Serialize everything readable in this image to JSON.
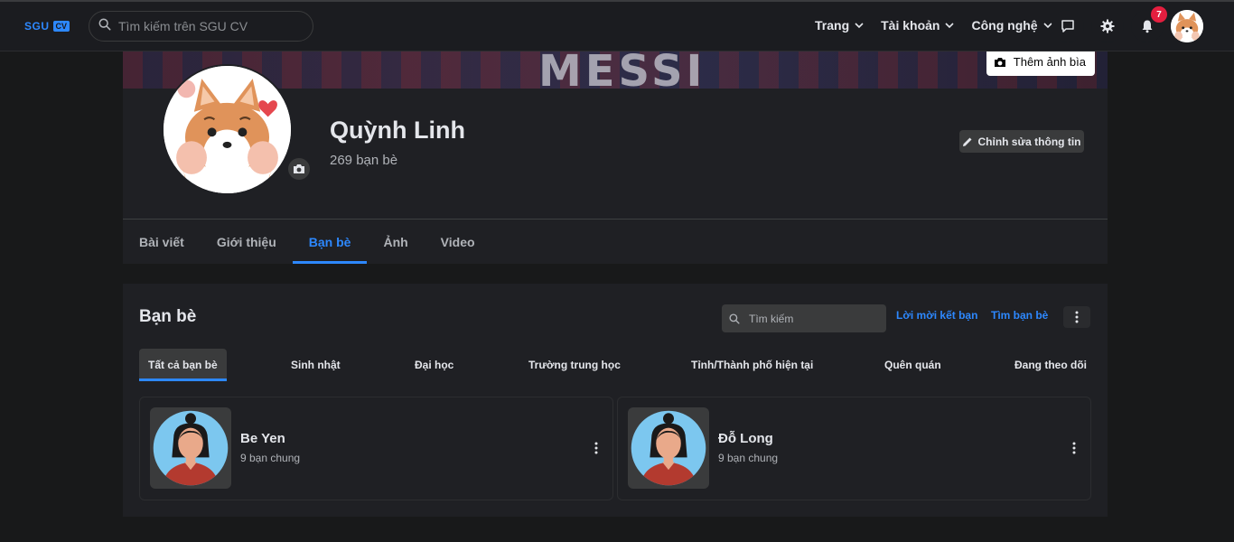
{
  "nav": {
    "logo_text": "SGU",
    "logo_badge": "CV",
    "search_placeholder": "Tìm kiếm trên SGU CV",
    "menus": [
      "Trang",
      "Tài khoản",
      "Công nghệ"
    ],
    "notification_count": "7"
  },
  "profile": {
    "cover_text": "MESSI",
    "add_cover_label": "Thêm ảnh bìa",
    "name": "Quỳnh Linh",
    "friend_count": "269 bạn bè",
    "edit_label": "Chỉnh sửa thông tin",
    "tabs": [
      {
        "label": "Bài viết",
        "active": false
      },
      {
        "label": "Giới thiệu",
        "active": false
      },
      {
        "label": "Bạn bè",
        "active": true
      },
      {
        "label": "Ảnh",
        "active": false
      },
      {
        "label": "Video",
        "active": false
      }
    ]
  },
  "friends": {
    "title": "Bạn bè",
    "search_placeholder": "Tìm kiếm",
    "requests_link": "Lời mời kết bạn",
    "find_link": "Tìm bạn bè",
    "tabs": [
      "Tất cả bạn bè",
      "Sinh nhật",
      "Đại học",
      "Trường trung học",
      "Tỉnh/Thành phố hiện tại",
      "Quên quán",
      "Đang theo dõi"
    ],
    "list": [
      {
        "name": "Be Yen",
        "mutual": "9 bạn chung"
      },
      {
        "name": "Đỗ Long",
        "mutual": "9 bạn chung"
      }
    ]
  },
  "colors": {
    "accent": "#2d88ff",
    "background": "#18191a",
    "card": "#1f2024",
    "badge": "#e41e3f"
  }
}
